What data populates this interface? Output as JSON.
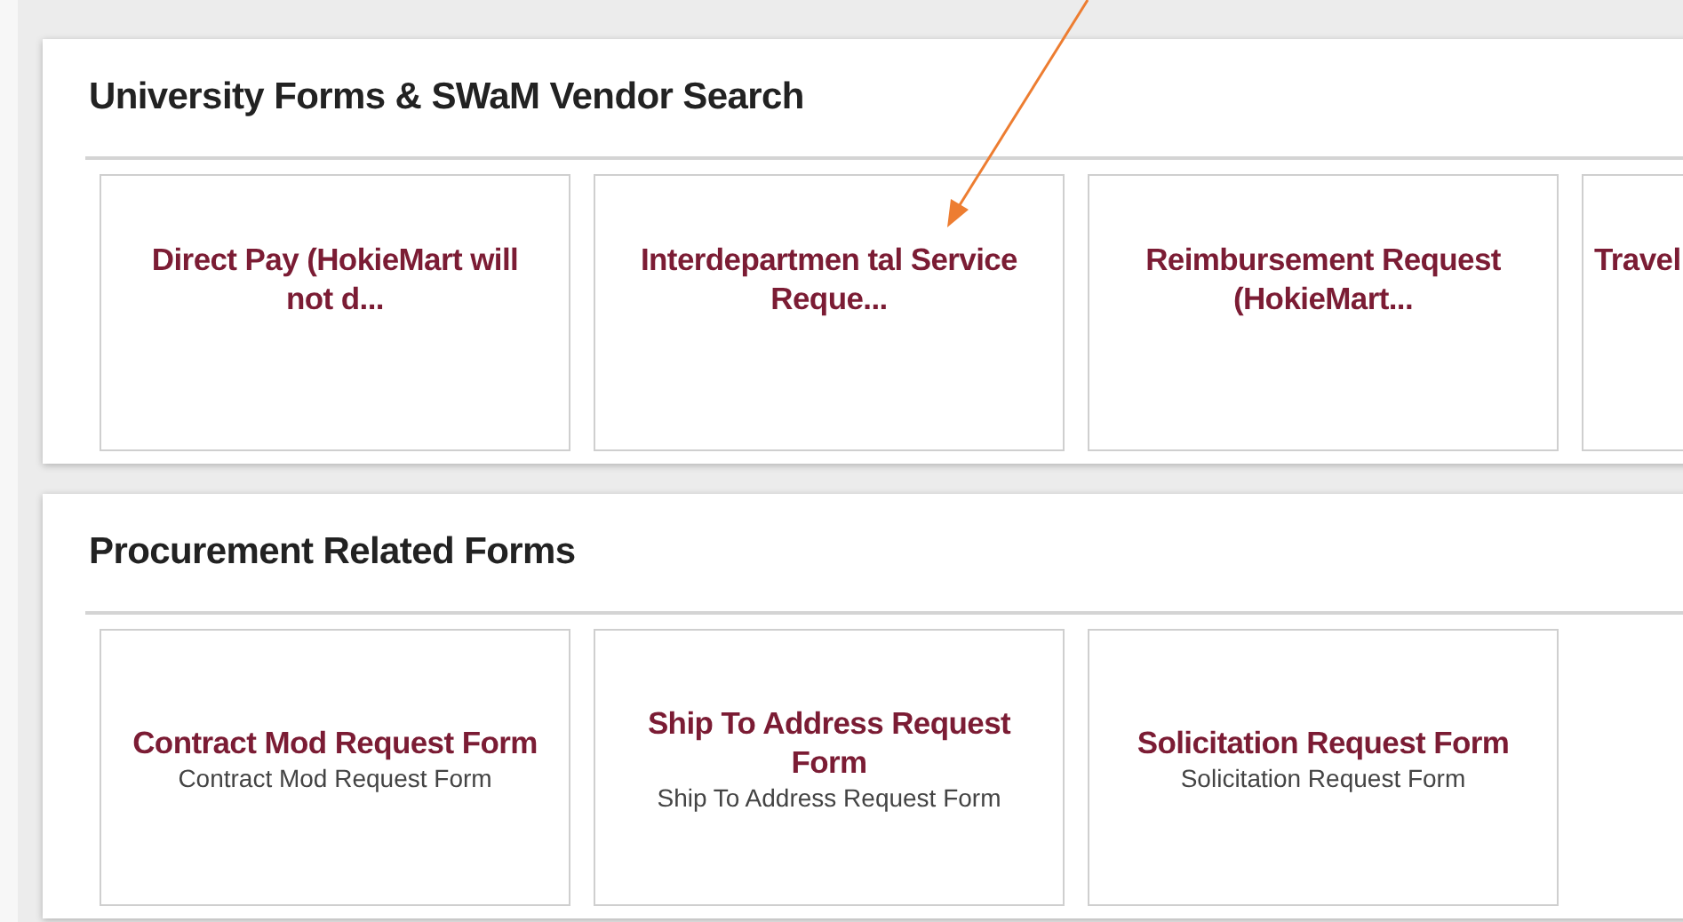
{
  "sections": [
    {
      "title": "University Forms & SWaM Vendor Search",
      "cards": [
        {
          "title": "Direct Pay (HokieMart will not d..."
        },
        {
          "title": "Interdepartmen tal Service Reque..."
        },
        {
          "title": "Reimbursement Request (HokieMart..."
        },
        {
          "title": "Travel"
        }
      ]
    },
    {
      "title": "Procurement Related Forms",
      "cards": [
        {
          "title": "Contract Mod Request Form",
          "subtitle": "Contract Mod Request Form"
        },
        {
          "title": "Ship To Address Request Form",
          "subtitle": "Ship To Address Request Form"
        },
        {
          "title": "Solicitation Request Form",
          "subtitle": "Solicitation Request Form"
        }
      ]
    }
  ]
}
